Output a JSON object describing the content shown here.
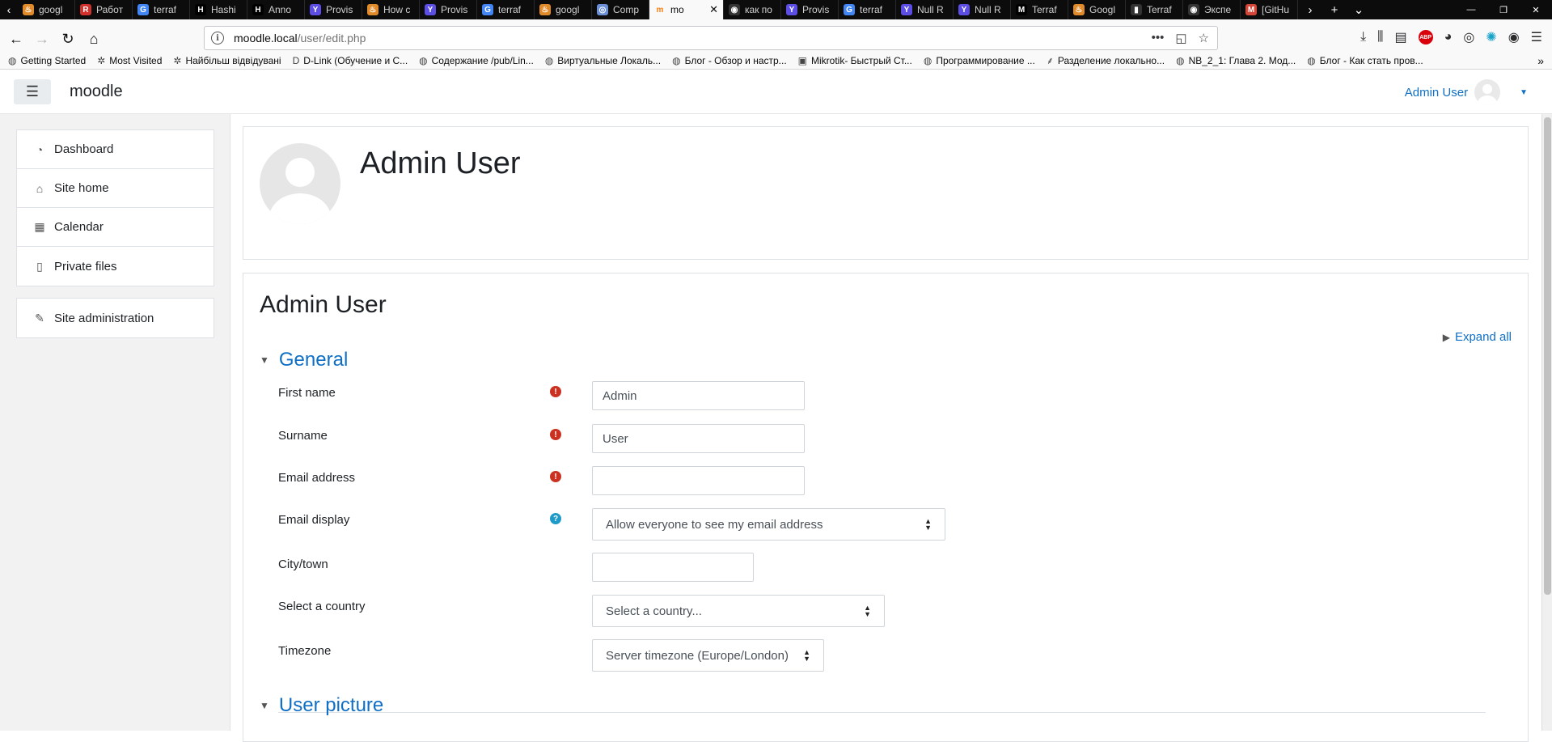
{
  "browser": {
    "tabs": [
      {
        "label": "googl",
        "color": "#e08a2a",
        "glyph": "♨"
      },
      {
        "label": "Работ",
        "color": "#d0312d",
        "glyph": "R"
      },
      {
        "label": "terraf",
        "color": "#4285f4",
        "glyph": "G"
      },
      {
        "label": "Hashi",
        "color": "#000000",
        "glyph": "H"
      },
      {
        "label": "Anno",
        "color": "#000000",
        "glyph": "H"
      },
      {
        "label": "Provis",
        "color": "#5c4ee5",
        "glyph": "Y"
      },
      {
        "label": "How c",
        "color": "#e08a2a",
        "glyph": "♨"
      },
      {
        "label": "Provis",
        "color": "#5c4ee5",
        "glyph": "Y"
      },
      {
        "label": "terraf",
        "color": "#4285f4",
        "glyph": "G"
      },
      {
        "label": "googl",
        "color": "#e08a2a",
        "glyph": "♨"
      },
      {
        "label": "Comp",
        "color": "#6b8fd6",
        "glyph": "◎"
      }
    ],
    "active_tab": {
      "label": "mo",
      "color": "#f98012",
      "glyph": "m"
    },
    "tabs_after": [
      {
        "label": "как по",
        "color": "#333333",
        "glyph": "◉"
      },
      {
        "label": "Provis",
        "color": "#5c4ee5",
        "glyph": "Y"
      },
      {
        "label": "terraf",
        "color": "#4285f4",
        "glyph": "G"
      },
      {
        "label": "Null R",
        "color": "#5c4ee5",
        "glyph": "Y"
      },
      {
        "label": "Null R",
        "color": "#5c4ee5",
        "glyph": "Y"
      },
      {
        "label": "Terraf",
        "color": "#000000",
        "glyph": "M"
      },
      {
        "label": "Googl",
        "color": "#e08a2a",
        "glyph": "♨"
      },
      {
        "label": "Terraf",
        "color": "#333333",
        "glyph": "▮"
      },
      {
        "label": "Экспе",
        "color": "#333333",
        "glyph": "◉"
      },
      {
        "label": "[GitHu",
        "color": "#d44638",
        "glyph": "M"
      }
    ],
    "url_host": "moodle.local",
    "url_path": "/user/edit.php",
    "bookmarks": [
      {
        "label": "Getting Started",
        "icon": "globe-icon"
      },
      {
        "label": "Most Visited",
        "icon": "gear-icon"
      },
      {
        "label": "Найбільш відвідувані",
        "icon": "gear-icon"
      },
      {
        "label": "D-Link (Обучение и С...",
        "icon": "dlink-icon"
      },
      {
        "label": "Содержание /pub/Lin...",
        "icon": "globe-icon"
      },
      {
        "label": "Виртуальные Локаль...",
        "icon": "globe-icon"
      },
      {
        "label": "Блог - Обзор и настр...",
        "icon": "globe-icon"
      },
      {
        "label": "Mikrotik- Быстрый Ст...",
        "icon": "mikrotik-icon"
      },
      {
        "label": "Программирование ...",
        "icon": "globe-icon"
      },
      {
        "label": "Разделение локально...",
        "icon": "feather-icon"
      },
      {
        "label": "NB_2_1: Глава 2. Мод...",
        "icon": "globe-icon"
      },
      {
        "label": "Блог - Как стать пров...",
        "icon": "globe-icon"
      }
    ]
  },
  "header": {
    "brand": "moodle",
    "user_name": "Admin User"
  },
  "sidebar": {
    "items": [
      {
        "label": "Dashboard",
        "icon": "dashboard-icon"
      },
      {
        "label": "Site home",
        "icon": "home-icon"
      },
      {
        "label": "Calendar",
        "icon": "calendar-icon"
      },
      {
        "label": "Private files",
        "icon": "file-icon"
      }
    ],
    "admin": {
      "label": "Site administration",
      "icon": "wrench-icon"
    }
  },
  "profile_header": {
    "name": "Admin User"
  },
  "form": {
    "heading": "Admin User",
    "expand_all": "Expand all",
    "general_section": "General",
    "picture_section": "User picture",
    "fields": {
      "first_name": {
        "label": "First name",
        "value": "Admin"
      },
      "surname": {
        "label": "Surname",
        "value": "User"
      },
      "email": {
        "label": "Email address",
        "value": ""
      },
      "email_display": {
        "label": "Email display",
        "value": "Allow everyone to see my email address"
      },
      "city": {
        "label": "City/town",
        "value": ""
      },
      "country": {
        "label": "Select a country",
        "value": "Select a country..."
      },
      "timezone": {
        "label": "Timezone",
        "value": "Server timezone (Europe/London)"
      }
    }
  },
  "colors": {
    "link": "#0f6fc5",
    "required": "#ca3120",
    "help": "#1f9bc9",
    "drawer_bg": "#f2f2f2"
  }
}
